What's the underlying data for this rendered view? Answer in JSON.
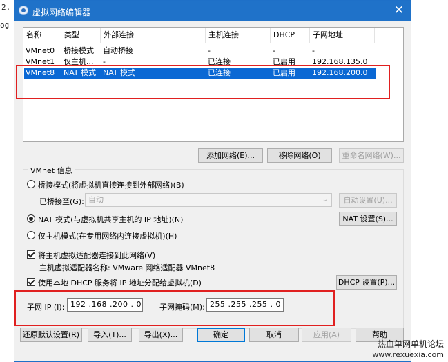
{
  "background": {
    "top_left": "2.",
    "mid_left": "og"
  },
  "window": {
    "title": "虚拟网络编辑器",
    "close": "✕"
  },
  "table": {
    "headers": [
      "名称",
      "类型",
      "外部连接",
      "主机连接",
      "DHCP",
      "子网地址"
    ],
    "rows": [
      [
        "VMnet0",
        "桥接模式",
        "自动桥接",
        "-",
        "-",
        "-"
      ],
      [
        "VMnet1",
        "仅主机...",
        "-",
        "已连接",
        "已启用",
        "192.168.135.0"
      ],
      [
        "VMnet8",
        "NAT 模式",
        "NAT 模式",
        "已连接",
        "已启用",
        "192.168.200.0"
      ]
    ],
    "selected_row": 2
  },
  "list_buttons": {
    "add": "添加网络(E)...",
    "remove": "移除网络(O)",
    "rename": "重命名网络(W)..."
  },
  "vmnet_info": {
    "label": "VMnet 信息",
    "bridged_radio": "桥接模式(将虚拟机直接连接到外部网络)(B)",
    "bridged_to_label": "已桥接至(G):",
    "bridged_to_value": "自动",
    "auto_settings": "自动设置(U)...",
    "nat_radio": "NAT 模式(与虚拟机共享主机的 IP 地址)(N)",
    "nat_settings": "NAT 设置(S)...",
    "hostonly_radio": "仅主机模式(在专用网络内连接虚拟机)(H)",
    "connect_adapter_check": "将主机虚拟适配器连接到此网络(V)",
    "adapter_name_text": "主机虚拟适配器名称: VMware 网络适配器 VMnet8",
    "dhcp_check": "使用本地 DHCP 服务将 IP 地址分配给虚拟机(D)",
    "dhcp_settings": "DHCP 设置(P)...",
    "subnet_ip_label": "子网 IP (I):",
    "subnet_ip_value": "192 .168 .200 . 0",
    "subnet_mask_label": "子网掩码(M):",
    "subnet_mask_value": "255 .255 .255 . 0"
  },
  "bottom_buttons": {
    "restore": "还原默认设置(R)",
    "import": "导入(T)...",
    "export": "导出(X)...",
    "ok": "确定",
    "cancel": "取消",
    "apply": "应用(A)",
    "help": "帮助"
  },
  "watermark": {
    "line1": "热血单网单机论坛",
    "line2": "www.rexuexia.com"
  },
  "colors": {
    "titlebar": "#1f72c9",
    "selection": "#0a68d4",
    "highlight_box": "#e02020"
  }
}
